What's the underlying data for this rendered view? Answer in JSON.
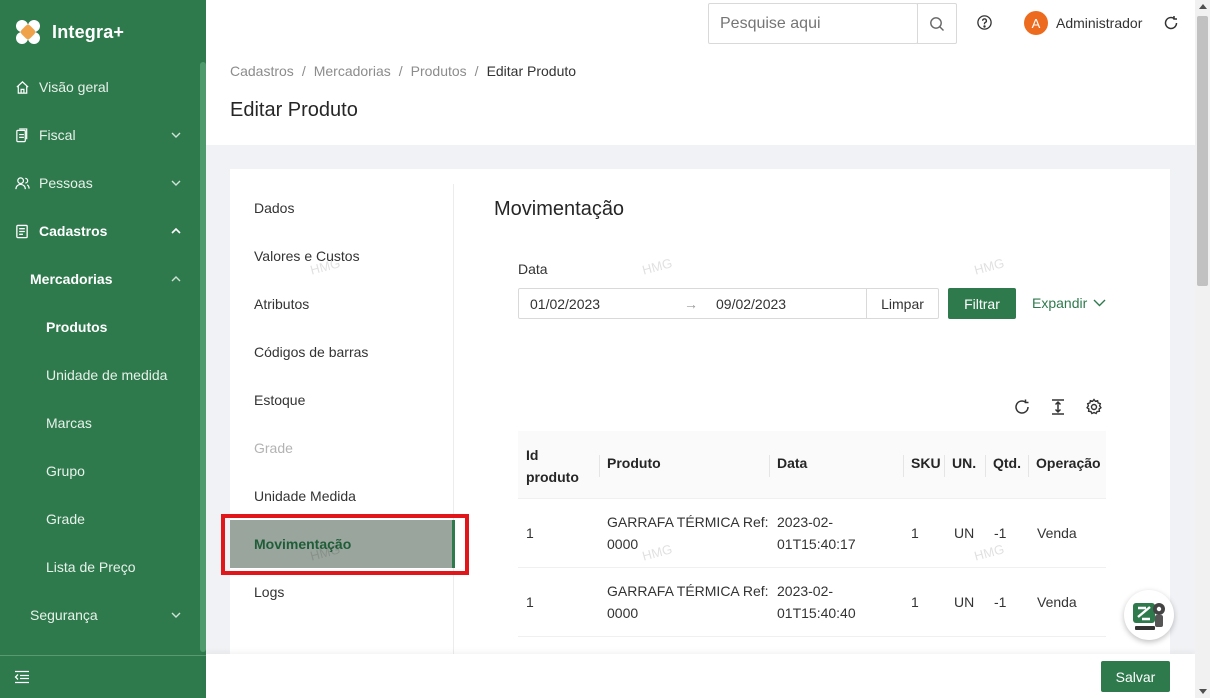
{
  "app": {
    "name": "Integra+"
  },
  "sidebar": {
    "items": [
      {
        "label": "Visão geral",
        "icon": "home-icon"
      },
      {
        "label": "Fiscal",
        "icon": "clipboard-icon"
      },
      {
        "label": "Pessoas",
        "icon": "people-icon"
      },
      {
        "label": "Cadastros",
        "icon": "register-icon"
      }
    ],
    "sub": {
      "group": "Mercadorias",
      "items": [
        "Produtos",
        "Unidade de medida",
        "Marcas",
        "Grupo",
        "Grade",
        "Lista de Preço"
      ]
    },
    "security": "Segurança"
  },
  "header": {
    "search_placeholder": "Pesquise aqui",
    "user_initial": "A",
    "user_name": "Administrador"
  },
  "breadcrumb": [
    "Cadastros",
    "Mercadorias",
    "Produtos",
    "Editar Produto"
  ],
  "breadcrumb_sep": "/",
  "page_title": "Editar Produto",
  "tabs": [
    "Dados",
    "Valores e Custos",
    "Atributos",
    "Códigos de barras",
    "Estoque",
    "Grade",
    "Unidade Medida",
    "Movimentação",
    "Logs"
  ],
  "section": {
    "title": "Movimentação",
    "date_label": "Data",
    "date_start": "01/02/2023",
    "date_arrow": "→",
    "date_end": "09/02/2023",
    "clear_label": "Limpar",
    "filter_label": "Filtrar",
    "expand_label": "Expandir"
  },
  "table": {
    "headers": {
      "id_line1": "Id",
      "id_line2": "produto",
      "produto": "Produto",
      "data": "Data",
      "sku": "SKU",
      "un": "UN.",
      "qtd": "Qtd.",
      "operacao": "Operação"
    },
    "rows": [
      {
        "id": "1",
        "produto_l1": "GARRAFA TÉRMICA Ref:",
        "produto_l2": "0000",
        "data_l1": "2023-02-",
        "data_l2": "01T15:40:17",
        "sku": "1",
        "un": "UN",
        "qtd": "-1",
        "operacao": "Venda"
      },
      {
        "id": "1",
        "produto_l1": "GARRAFA TÉRMICA Ref:",
        "produto_l2": "0000",
        "data_l1": "2023-02-",
        "data_l2": "01T15:40:40",
        "sku": "1",
        "un": "UN",
        "qtd": "-1",
        "operacao": "Venda"
      }
    ]
  },
  "footer": {
    "save_label": "Salvar"
  },
  "watermark": "HMG",
  "colors": {
    "primary": "#2e7a4d",
    "avatar": "#ed6b1e",
    "highlight": "#e0161b"
  }
}
